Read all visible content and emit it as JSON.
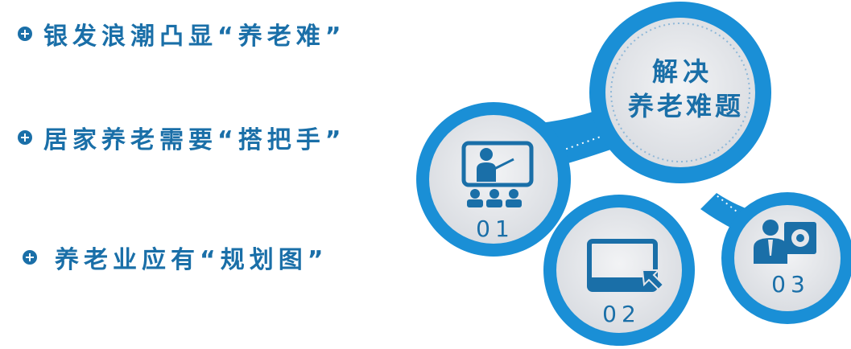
{
  "points": [
    "银发浪潮凸显“养老难”",
    "居家养老需要“搭把手”",
    "养老业应有“规划图”"
  ],
  "center": {
    "line1": "解决",
    "line2": "养老难题"
  },
  "nodes": [
    {
      "number": "01",
      "icon": "teacher-presentation-icon"
    },
    {
      "number": "02",
      "icon": "tablet-cursor-icon"
    },
    {
      "number": "03",
      "icon": "businessman-gear-icon"
    }
  ],
  "colors": {
    "accent": "#1a8fd6",
    "text": "#1a6fa8",
    "disc": "#e4e6ea"
  }
}
